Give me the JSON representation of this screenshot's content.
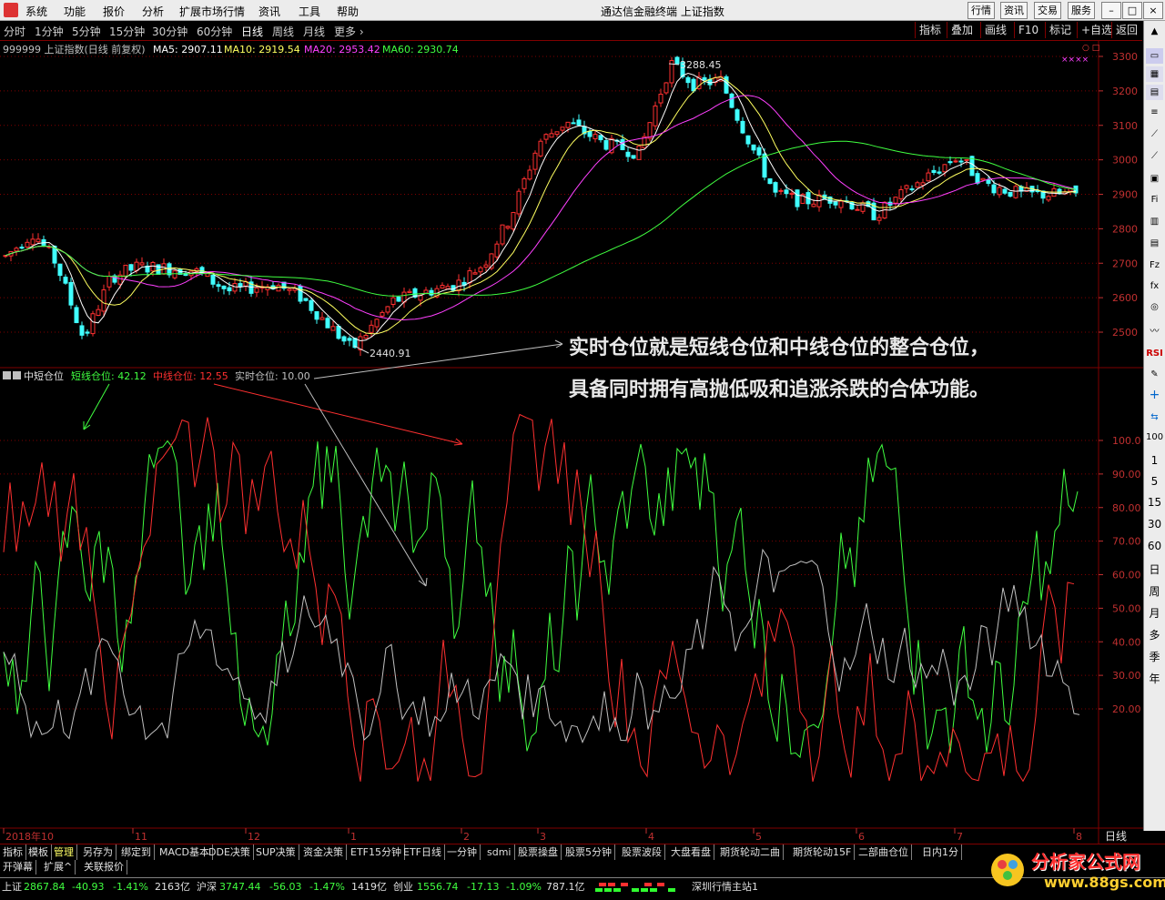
{
  "menubar": {
    "items": [
      "系统",
      "功能",
      "报价",
      "分析",
      "扩展市场行情",
      "资讯",
      "工具",
      "帮助"
    ],
    "title": "通达信金融终端   上证指数",
    "right_buttons": [
      "行情",
      "资讯",
      "交易",
      "服务"
    ]
  },
  "periodbar": {
    "items": [
      "分时",
      "1分钟",
      "5分钟",
      "15分钟",
      "30分钟",
      "60分钟",
      "日线",
      "周线",
      "月线",
      "更多 ›"
    ],
    "active": "日线",
    "tools": [
      "指标",
      "叠加",
      "画线",
      "F10",
      "标记",
      "+自选",
      "返回"
    ]
  },
  "main_header": {
    "code_name": "999999 上证指数(日线 前复权)",
    "ma5": "MA5: 2907.11",
    "ma10": "MA10: 2919.54",
    "ma20": "MA20: 2953.42",
    "ma60": "MA60: 2930.74"
  },
  "price_annotations": {
    "high": "3288.45",
    "low": "2440.91"
  },
  "price_axis": [
    "3300",
    "3200",
    "3100",
    "3000",
    "2900",
    "2800",
    "2700",
    "2600",
    "2500"
  ],
  "indicator_header": {
    "name": "中短仓位",
    "short": "短线仓位: 42.12",
    "mid": "中线仓位: 12.55",
    "real": "实时仓位: 10.00"
  },
  "indicator_axis": [
    "100.0",
    "90.00",
    "80.00",
    "70.00",
    "60.00",
    "50.00",
    "40.00",
    "30.00",
    "20.00"
  ],
  "overlay_text": {
    "line1": "实时仓位就是短线仓位和中线仓位的整合仓位，",
    "line2": "具备同时拥有高抛低吸和追涨杀跌的合体功能。"
  },
  "date_axis": [
    "2018年10",
    "11",
    "12",
    "1",
    "2",
    "3",
    "4",
    "5",
    "6",
    "7",
    "8"
  ],
  "date_axis_right": "日线",
  "right_toolbar": {
    "icons": [
      "RSI",
      "+",
      "⇆"
    ],
    "texts": [
      "100",
      "1",
      "5",
      "15",
      "30",
      "60",
      "日",
      "周",
      "月",
      "多",
      "季",
      "年"
    ]
  },
  "bottom_tabs": [
    "指标",
    "模板",
    "管理",
    "另存为",
    "绑定到",
    "MACD基本",
    "DDE决策",
    "SUP决策",
    "资金决策",
    "ETF15分钟",
    "ETF日线",
    "一分钟",
    "sdmi",
    "股票操盘",
    "股票5分钟",
    "股票波段",
    "大盘看盘",
    "期货轮动二曲",
    "期货轮动15F",
    "二部曲仓位",
    "日内1分"
  ],
  "bottom_tabs_active": "管理",
  "bottom_tabs2": [
    "开弹幕",
    "扩展^",
    "关联报价"
  ],
  "status": {
    "sh_label": "上证",
    "sh_value": "2867.84",
    "sh_change": "-40.93",
    "sh_pct": "-1.41%",
    "sh_amount": "2163亿",
    "hs_label": "沪深",
    "hs_value": "3747.44",
    "hs_change": "-56.03",
    "hs_pct": "-1.47%",
    "hs_amount": "1419亿",
    "cy_label": "创业",
    "cy_value": "1556.74",
    "cy_change": "-17.13",
    "cy_pct": "-1.09%",
    "cy_amount": "787.1亿",
    "station": "深圳行情主站1"
  },
  "watermark": {
    "title": "分析家公式网",
    "url": "www.88gs.com"
  },
  "colors": {
    "up": "#ff3030",
    "down": "#40ffff",
    "ma5": "#ffffff",
    "ma10": "#ffff60",
    "ma20": "#ff40ff",
    "ma60": "#40ff40",
    "short": "#40ff40",
    "mid": "#ff3030",
    "real": "#c0c0c0",
    "grid": "#800000"
  }
}
